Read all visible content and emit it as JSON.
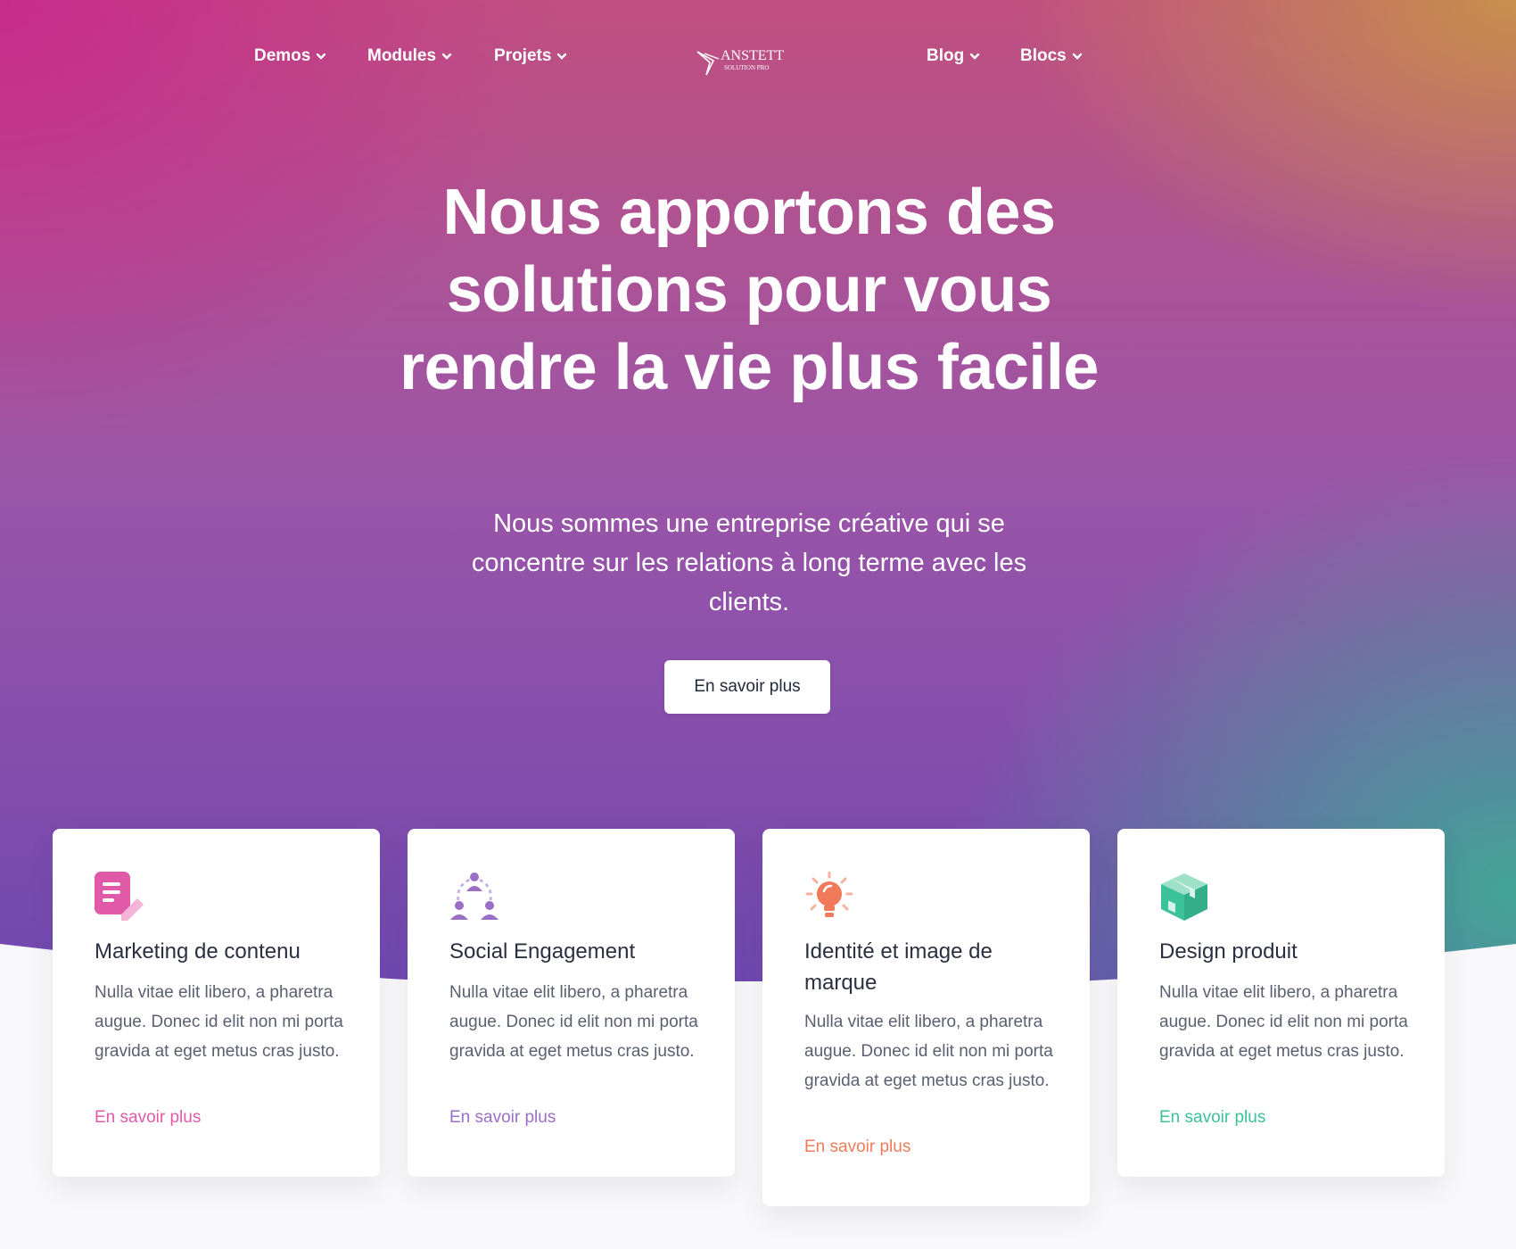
{
  "nav": {
    "left": [
      {
        "label": "Demos"
      },
      {
        "label": "Modules"
      },
      {
        "label": "Projets"
      }
    ],
    "right": [
      {
        "label": "Blog"
      },
      {
        "label": "Blocs"
      }
    ],
    "logo": {
      "name": "ANSTETT",
      "tagline": "SOLUTION PRO"
    }
  },
  "hero": {
    "title": "Nous apportons des solutions pour vous rendre la vie plus facile",
    "subtitle": "Nous sommes une entreprise créative qui se concentre sur les relations à long terme avec les clients.",
    "cta_label": "En savoir plus"
  },
  "cards": [
    {
      "title": "Marketing de contenu",
      "text": "Nulla vitae elit libero, a pharetra augue. Donec id elit non mi porta gravida at eget metus cras justo.",
      "link": "En savoir plus",
      "accent": "#e05aa8",
      "icon": "document-edit-icon"
    },
    {
      "title": "Social Engagement",
      "text": "Nulla vitae elit libero, a pharetra augue. Donec id elit non mi porta gravida at eget metus cras justo.",
      "link": "En savoir plus",
      "accent": "#9a6fc4",
      "icon": "users-network-icon"
    },
    {
      "title": "Identité et image de marque",
      "text": "Nulla vitae elit libero, a pharetra augue. Donec id elit non mi porta gravida at eget metus cras justo.",
      "link": "En savoir plus",
      "accent": "#f07a5a",
      "icon": "lightbulb-icon"
    },
    {
      "title": "Design produit",
      "text": "Nulla vitae elit libero, a pharetra augue. Donec id elit non mi porta gravida at eget metus cras justo.",
      "link": "En savoir plus",
      "accent": "#3cc29a",
      "icon": "box-icon"
    }
  ]
}
